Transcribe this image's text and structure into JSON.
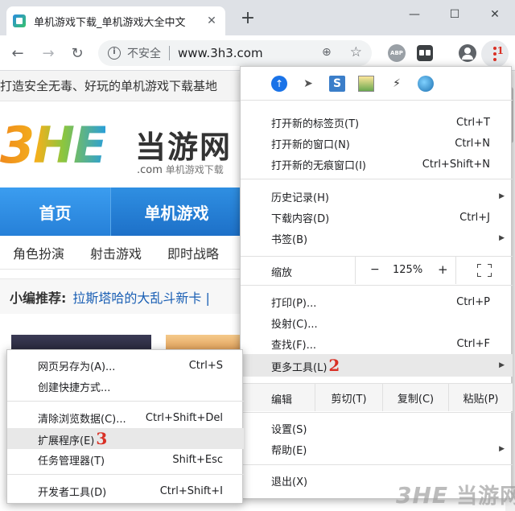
{
  "tab": {
    "title": "单机游戏下载_单机游戏大全中文",
    "close": "✕"
  },
  "window": {
    "minimize": "—",
    "maximize": "☐",
    "close": "✕",
    "new_tab": "+"
  },
  "toolbar": {
    "back": "←",
    "forward": "→",
    "reload": "↻",
    "security_label": "不安全",
    "url": "www.3h3.com",
    "zoom_icon": "⊕",
    "star": "☆",
    "abp_label": "ABP",
    "menu_step": "1"
  },
  "page": {
    "slogan": "打造安全无毒、好玩的单机游戏下载基地",
    "logo_letters": "3HE",
    "logo_cn": "当游网",
    "logo_sub_domain": ".com",
    "logo_sub_text": "单机游戏下载",
    "nav": [
      "首页",
      "单机游戏"
    ],
    "subnav": [
      "角色扮演",
      "射击游戏",
      "即时战略"
    ],
    "recommend_label": "小编推荐:",
    "recommend_link": "拉斯塔哈的大乱斗新卡 |"
  },
  "main_menu": {
    "new_tab": {
      "label": "打开新的标签页(T)",
      "shortcut": "Ctrl+T"
    },
    "new_window": {
      "label": "打开新的窗口(N)",
      "shortcut": "Ctrl+N"
    },
    "new_incognito": {
      "label": "打开新的无痕窗口(I)",
      "shortcut": "Ctrl+Shift+N"
    },
    "history": {
      "label": "历史记录(H)"
    },
    "downloads": {
      "label": "下载内容(D)",
      "shortcut": "Ctrl+J"
    },
    "bookmarks": {
      "label": "书签(B)"
    },
    "zoom": {
      "label": "缩放",
      "minus": "−",
      "value": "125%",
      "plus": "+"
    },
    "print": {
      "label": "打印(P)...",
      "shortcut": "Ctrl+P"
    },
    "cast": {
      "label": "投射(C)..."
    },
    "find": {
      "label": "查找(F)...",
      "shortcut": "Ctrl+F"
    },
    "more_tools": {
      "label": "更多工具(L)",
      "step": "2"
    },
    "edit": {
      "label": "编辑",
      "cut": "剪切(T)",
      "copy": "复制(C)",
      "paste": "粘贴(P)"
    },
    "settings": {
      "label": "设置(S)"
    },
    "help": {
      "label": "帮助(E)"
    },
    "exit": {
      "label": "退出(X)"
    }
  },
  "sub_menu": {
    "save_page": {
      "label": "网页另存为(A)...",
      "shortcut": "Ctrl+S"
    },
    "create_shortcut": {
      "label": "创建快捷方式..."
    },
    "clear_data": {
      "label": "清除浏览数据(C)...",
      "shortcut": "Ctrl+Shift+Del"
    },
    "extensions": {
      "label": "扩展程序(E)",
      "step": "3"
    },
    "task_manager": {
      "label": "任务管理器(T)",
      "shortcut": "Shift+Esc"
    },
    "dev_tools": {
      "label": "开发者工具(D)",
      "shortcut": "Ctrl+Shift+I"
    }
  },
  "watermark": {
    "logo": "3HE",
    "text": "当游网"
  },
  "colors": {
    "accent": "#1a73e8",
    "step_red": "#d93025",
    "nav_blue": "#2680d8"
  }
}
